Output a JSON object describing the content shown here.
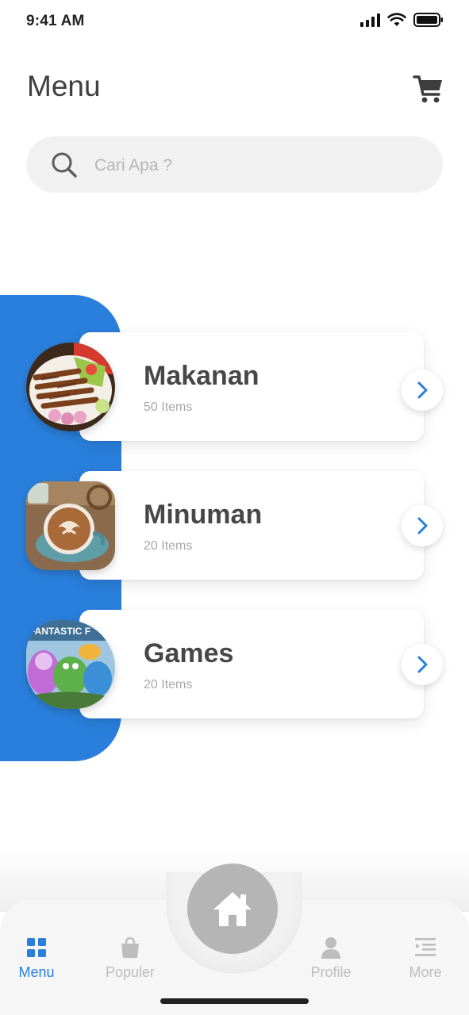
{
  "status_bar": {
    "time": "9:41 AM"
  },
  "header": {
    "title": "Menu",
    "cart_icon": "cart-icon"
  },
  "search": {
    "placeholder": "Cari Apa ?",
    "value": ""
  },
  "colors": {
    "accent": "#2a7fdc",
    "inactive": "#bdbdbd",
    "title": "#474747"
  },
  "categories": [
    {
      "title": "Makanan",
      "count": "50 Items",
      "image": "satay-plate"
    },
    {
      "title": "Minuman",
      "count": "20 Items",
      "image": "latte-coffee"
    },
    {
      "title": "Games",
      "count": "20 Items",
      "image": "fantastic-game-cover"
    }
  ],
  "nav": {
    "items": [
      {
        "label": "Menu",
        "icon": "grid-icon",
        "active": true
      },
      {
        "label": "Populer",
        "icon": "bag-icon",
        "active": false
      },
      {
        "label": "Profile",
        "icon": "user-icon",
        "active": false
      },
      {
        "label": "More",
        "icon": "list-icon",
        "active": false
      }
    ],
    "home_icon": "home-icon"
  },
  "thumb_labels": {
    "games": "FANTASTIC F"
  }
}
